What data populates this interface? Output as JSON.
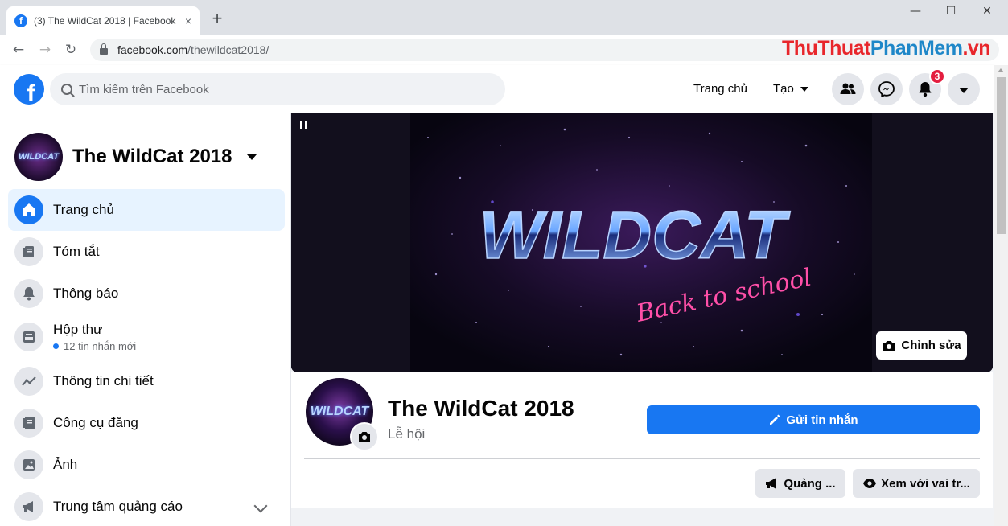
{
  "browser": {
    "tab_title": "(3) The WildCat 2018 | Facebook",
    "tab_close": "×",
    "new_tab": "+",
    "window_minimize": "—",
    "window_maximize": "☐",
    "window_close": "✕",
    "back": "←",
    "forward": "→",
    "reload": "↻",
    "url_domain": "facebook.com",
    "url_path": "/thewildcat2018/"
  },
  "watermark": {
    "part1": "ThuThuat",
    "part2": "PhanMem",
    "part3": ".vn"
  },
  "header": {
    "logo": "f",
    "search_placeholder": "Tìm kiếm trên Facebook",
    "home_label": "Trang chủ",
    "create_label": "Tạo",
    "notification_count": "3"
  },
  "sidebar": {
    "page_name": "The WildCat 2018",
    "avatar_text": "WILDCAT",
    "items": [
      {
        "label": "Trang chủ",
        "icon": "home-icon"
      },
      {
        "label": "Tóm tắt",
        "icon": "summary-icon"
      },
      {
        "label": "Thông báo",
        "icon": "bell-icon"
      },
      {
        "label": "Hộp thư",
        "icon": "inbox-icon",
        "sub": "12 tin nhắn mới"
      },
      {
        "label": "Thông tin chi tiết",
        "icon": "insights-icon"
      },
      {
        "label": "Công cụ đăng",
        "icon": "publishing-tools-icon"
      },
      {
        "label": "Ảnh",
        "icon": "photos-icon"
      },
      {
        "label": "Trung tâm quảng cáo",
        "icon": "megaphone-icon"
      }
    ]
  },
  "cover": {
    "logo_text": "WILDCAT",
    "tagline": "Back to school",
    "edit_label": "Chỉnh sửa"
  },
  "profile": {
    "title": "The WildCat 2018",
    "category": "Lễ hội",
    "avatar_text": "WILDCAT",
    "send_message": "Gửi tin nhắn",
    "promote": "Quảng ...",
    "view_as": "Xem với vai tr..."
  },
  "colors": {
    "facebook_blue": "#1877f2",
    "active_nav_bg": "#e7f3ff",
    "badge_red": "#e41e3f",
    "watermark_red": "#e8262b",
    "watermark_blue": "#1e87c8"
  }
}
